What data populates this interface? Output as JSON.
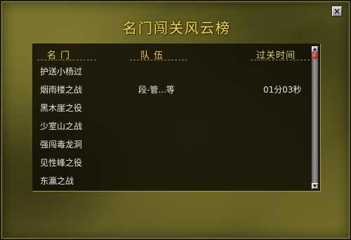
{
  "window": {
    "title": "名门闯关风云榜",
    "close_glyph": "×"
  },
  "table": {
    "headers": {
      "name": "名门",
      "team": "队伍",
      "time": "过关时间"
    },
    "rows": [
      {
        "name": "护送小杨过",
        "team": "",
        "time": ""
      },
      {
        "name": "烟雨楼之战",
        "team": "段-管...等",
        "time": "01分03秒"
      },
      {
        "name": "黑木崖之役",
        "team": "",
        "time": ""
      },
      {
        "name": "少室山之战",
        "team": "",
        "time": ""
      },
      {
        "name": "强闯毒龙洞",
        "team": "",
        "time": ""
      },
      {
        "name": "见性峰之役",
        "team": "",
        "time": ""
      },
      {
        "name": "东瀛之战",
        "team": "",
        "time": ""
      }
    ]
  },
  "icons": {
    "close": "close-icon",
    "scroll_up": "arrow-up-icon",
    "scroll_down": "arrow-down-icon",
    "scroll_thumb": "scroll-thumb-orb"
  },
  "colors": {
    "title": "#f2d44a",
    "header": "#e8cf63",
    "row_text": "#e6e6e6",
    "panel_bg": "#0e0d04",
    "frame_bg": "#6e6a2a",
    "scroll_thumb": "#b01808"
  }
}
